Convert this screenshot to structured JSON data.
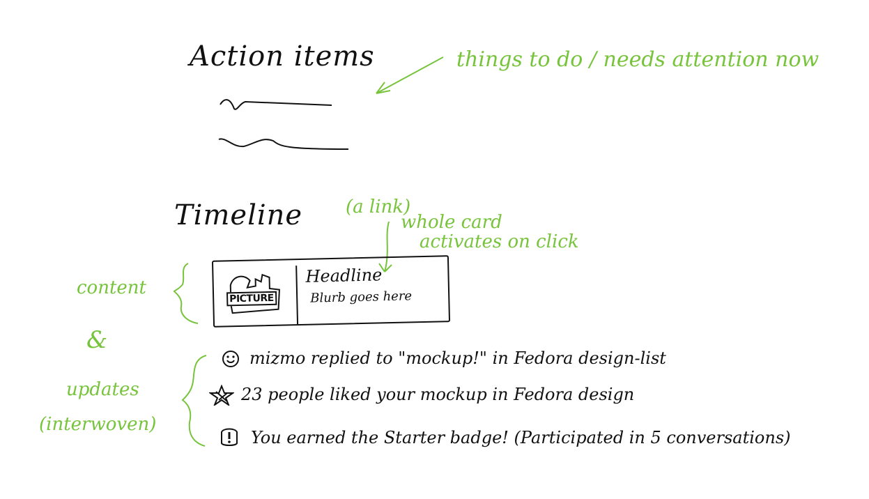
{
  "sections": {
    "action_items": "Action items",
    "timeline": "Timeline"
  },
  "notes": {
    "things_to_do": "things to do / needs attention now",
    "a_link": "(a link)",
    "whole_card": "whole card",
    "activates": "activates on click",
    "content": "content",
    "ampersand": "&",
    "updates": "updates",
    "interwoven": "(interwoven)"
  },
  "card": {
    "picture_label": "PICTURE",
    "headline": "Headline",
    "blurb": "Blurb goes here"
  },
  "updates": [
    {
      "icon": "smiley-icon",
      "text": "mizmo replied to \"mockup!\" in Fedora design-list"
    },
    {
      "icon": "star-icon",
      "text": "23 people liked your mockup in Fedora design"
    },
    {
      "icon": "exclamation-icon",
      "text": "You earned the Starter badge! (Participated in 5 conversations)"
    }
  ],
  "colors": {
    "ink": "#111111",
    "annotation": "#77c43c"
  }
}
